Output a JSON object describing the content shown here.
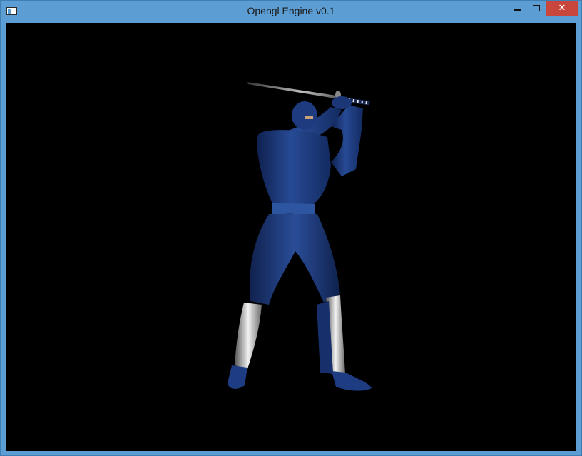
{
  "window": {
    "title": "Opengl Engine v0.1",
    "app_icon": "window-icon",
    "controls": {
      "minimize_icon": "minimize-icon",
      "maximize_icon": "maximize-icon",
      "close_icon": "close-icon",
      "close_glyph": "✕"
    },
    "colors": {
      "titlebar": "#5c9ed3",
      "close_button": "#c9463d",
      "viewport_background": "#000000"
    }
  },
  "viewport": {
    "scene_subject": "ninja-model-icon",
    "colors": {
      "outfit": "#1f3f86",
      "blade": "#9a9a9a",
      "shin_guards": "#d8d8d8"
    }
  }
}
